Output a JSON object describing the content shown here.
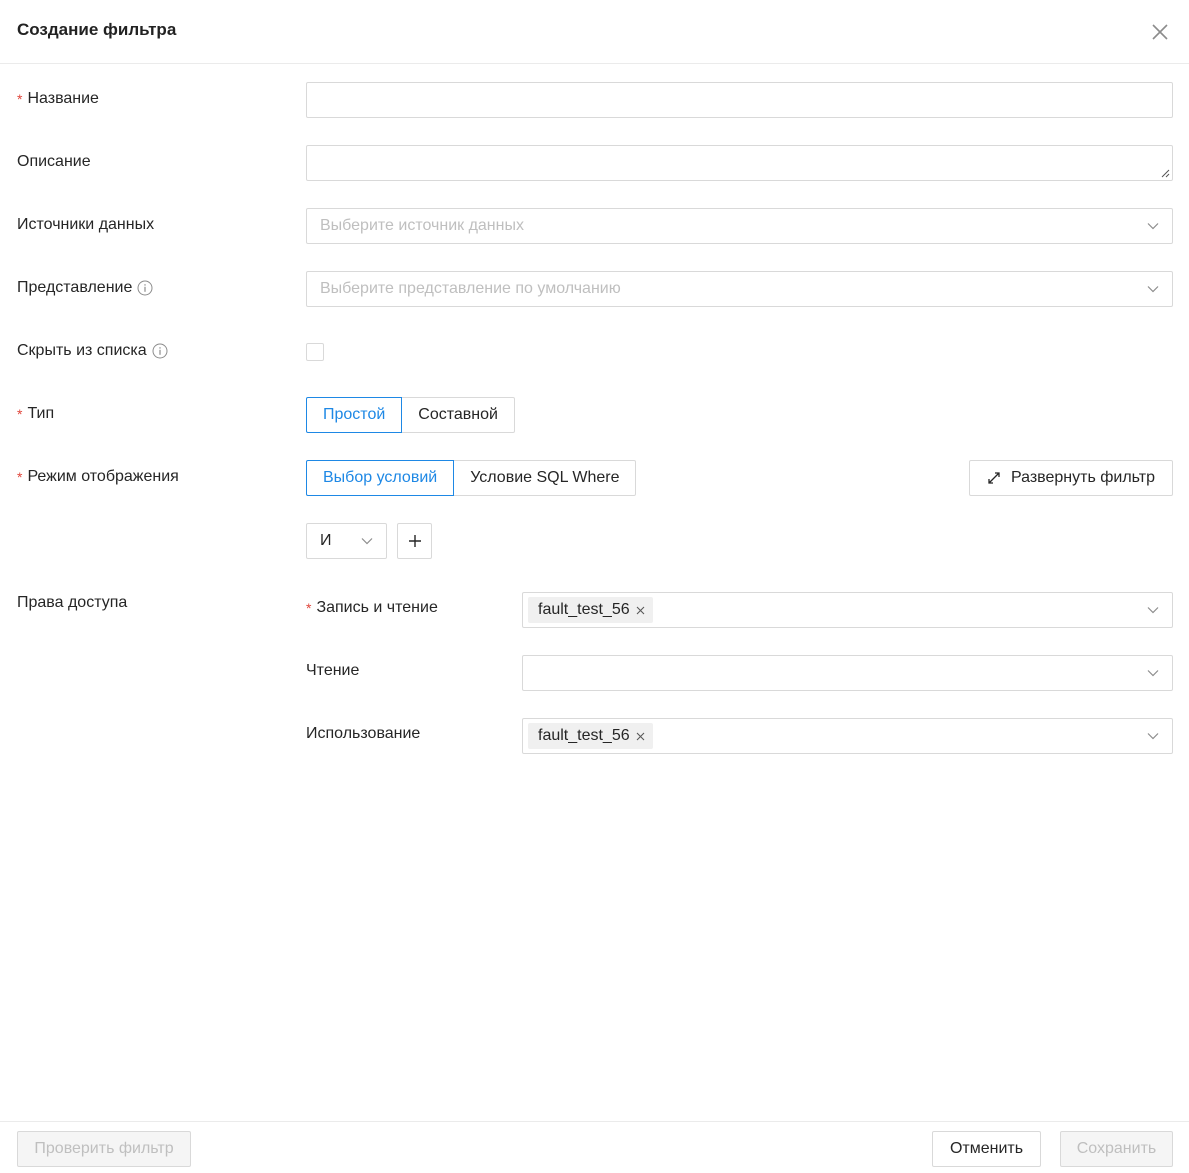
{
  "dialog": {
    "title": "Создание фильтра"
  },
  "fields": {
    "name": {
      "label": "Название",
      "value": ""
    },
    "description": {
      "label": "Описание",
      "value": ""
    },
    "datasources": {
      "label": "Источники данных",
      "placeholder": "Выберите источник данных"
    },
    "view": {
      "label": "Представление",
      "placeholder": "Выберите представление по умолчанию"
    },
    "hide": {
      "label": "Скрыть из списка",
      "checked": false
    },
    "type": {
      "label": "Тип",
      "options": [
        "Простой",
        "Составной"
      ],
      "selected": "Простой"
    },
    "display_mode": {
      "label": "Режим отображения",
      "options": [
        "Выбор условий",
        "Условие SQL Where"
      ],
      "selected": "Выбор условий"
    }
  },
  "expand_button": {
    "label": "Развернуть фильтр",
    "icon": "expand-arrows-icon"
  },
  "condition": {
    "operator": "И",
    "add_icon": "plus-icon"
  },
  "access": {
    "label": "Права доступа",
    "write_read": {
      "label": "Запись и чтение",
      "tags": [
        "fault_test_56"
      ]
    },
    "read": {
      "label": "Чтение",
      "tags": []
    },
    "usage": {
      "label": "Использование",
      "tags": [
        "fault_test_56"
      ]
    }
  },
  "footer": {
    "check_label": "Проверить фильтр",
    "cancel_label": "Отменить",
    "save_label": "Сохранить"
  },
  "colors": {
    "accent": "#1e88e5",
    "required": "#e0443a",
    "border": "#d9d9d9",
    "placeholder": "#bfbfbf"
  }
}
